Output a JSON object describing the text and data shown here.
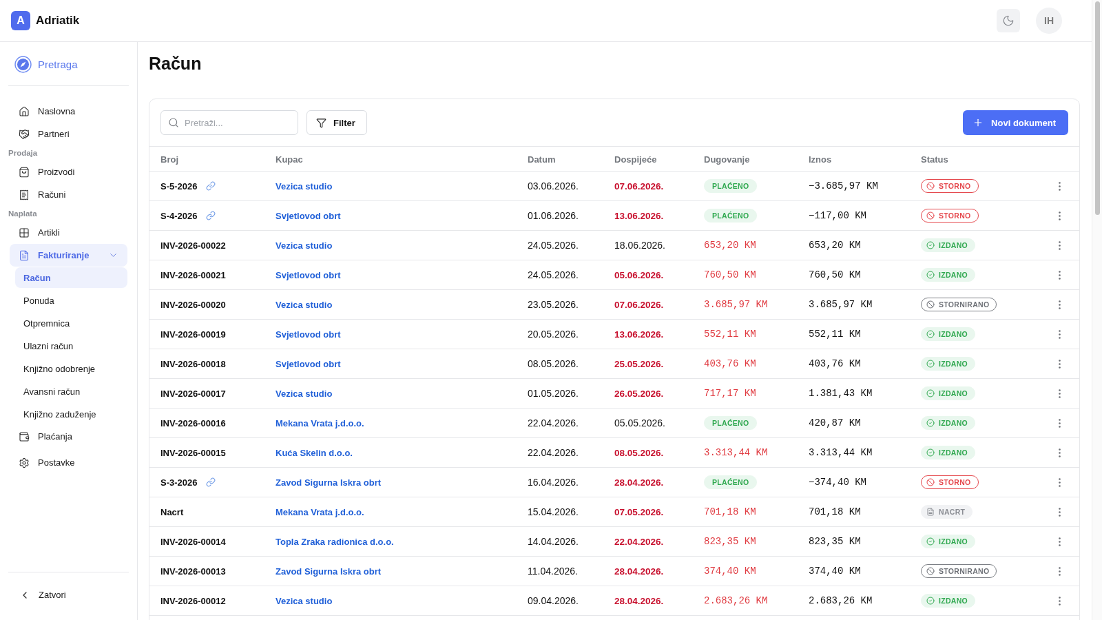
{
  "app": {
    "logo": "A",
    "name": "Adriatik"
  },
  "header": {
    "avatar": "IH"
  },
  "sidebar": {
    "search": "Pretraga",
    "items": [
      {
        "kind": "link",
        "label": "Naslovna",
        "selected": false
      },
      {
        "kind": "link",
        "label": "Partneri",
        "selected": false
      },
      {
        "kind": "section",
        "label": "Prodaja"
      },
      {
        "kind": "link",
        "label": "Proizvodi",
        "selected": false
      },
      {
        "kind": "link",
        "label": "Računi",
        "selected": false
      },
      {
        "kind": "section",
        "label": "Naplata"
      },
      {
        "kind": "link",
        "label": "Artikli",
        "selected": false
      },
      {
        "kind": "group",
        "label": "Fakturiranje",
        "selected": true,
        "expanded": true,
        "children": [
          {
            "label": "Račun",
            "selected": true
          },
          {
            "label": "Ponuda",
            "selected": false
          },
          {
            "label": "Otpremnica",
            "selected": false
          },
          {
            "label": "Ulazni račun",
            "selected": false
          },
          {
            "label": "Knjižno odobrenje",
            "selected": false
          },
          {
            "label": "Avansni račun",
            "selected": false
          },
          {
            "label": "Knjižno zaduženje",
            "selected": false
          }
        ]
      },
      {
        "kind": "link",
        "label": "Plaćanja",
        "selected": false
      },
      {
        "kind": "link",
        "label": "Postavke",
        "selected": false
      }
    ],
    "collapse": "Zatvori"
  },
  "page": {
    "title": "Račun"
  },
  "toolbar": {
    "search": {
      "placeholder": "Pretraži..."
    },
    "filter": "Filter",
    "new_document": "Novi dokument"
  },
  "table": {
    "columns": [
      "Broj",
      "Kupac",
      "Datum",
      "Dospijeće",
      "Dugovanje",
      "Iznos",
      "Status"
    ],
    "rows": [
      {
        "number": "S-5-2026",
        "linked": true,
        "customer": "Vezica studio",
        "date": "03.06.2026.",
        "due": "07.06.2026.",
        "overdue": true,
        "debt": {
          "kind": "badge",
          "text": "PLAĆENO"
        },
        "amount": "−3.685,97 KM",
        "status": {
          "kind": "storno",
          "text": "STORNO"
        }
      },
      {
        "number": "S-4-2026",
        "linked": true,
        "customer": "Svjetlovod obrt",
        "date": "01.06.2026.",
        "due": "13.06.2026.",
        "overdue": true,
        "debt": {
          "kind": "badge",
          "text": "PLAĆENO"
        },
        "amount": "−117,00 KM",
        "status": {
          "kind": "storno",
          "text": "STORNO"
        }
      },
      {
        "number": "INV-2026-00022",
        "linked": false,
        "customer": "Vezica studio",
        "date": "24.05.2026.",
        "due": "18.06.2026.",
        "overdue": false,
        "debt": {
          "kind": "amount",
          "text": "653,20 KM"
        },
        "amount": "653,20 KM",
        "status": {
          "kind": "issued",
          "text": "IZDANO"
        }
      },
      {
        "number": "INV-2026-00021",
        "linked": false,
        "customer": "Svjetlovod obrt",
        "date": "24.05.2026.",
        "due": "05.06.2026.",
        "overdue": true,
        "debt": {
          "kind": "amount",
          "text": "760,50 KM"
        },
        "amount": "760,50 KM",
        "status": {
          "kind": "issued",
          "text": "IZDANO"
        }
      },
      {
        "number": "INV-2026-00020",
        "linked": false,
        "customer": "Vezica studio",
        "date": "23.05.2026.",
        "due": "07.06.2026.",
        "overdue": true,
        "debt": {
          "kind": "amount",
          "text": "3.685,97 KM"
        },
        "amount": "3.685,97 KM",
        "status": {
          "kind": "cancelled",
          "text": "STORNIRANO"
        }
      },
      {
        "number": "INV-2026-00019",
        "linked": false,
        "customer": "Svjetlovod obrt",
        "date": "20.05.2026.",
        "due": "13.06.2026.",
        "overdue": true,
        "debt": {
          "kind": "amount",
          "text": "552,11 KM"
        },
        "amount": "552,11 KM",
        "status": {
          "kind": "issued",
          "text": "IZDANO"
        }
      },
      {
        "number": "INV-2026-00018",
        "linked": false,
        "customer": "Svjetlovod obrt",
        "date": "08.05.2026.",
        "due": "25.05.2026.",
        "overdue": true,
        "debt": {
          "kind": "amount",
          "text": "403,76 KM"
        },
        "amount": "403,76 KM",
        "status": {
          "kind": "issued",
          "text": "IZDANO"
        }
      },
      {
        "number": "INV-2026-00017",
        "linked": false,
        "customer": "Vezica studio",
        "date": "01.05.2026.",
        "due": "26.05.2026.",
        "overdue": true,
        "debt": {
          "kind": "amount",
          "text": "717,17 KM"
        },
        "amount": "1.381,43 KM",
        "status": {
          "kind": "issued",
          "text": "IZDANO"
        }
      },
      {
        "number": "INV-2026-00016",
        "linked": false,
        "customer": "Mekana Vrata j.d.o.o.",
        "date": "22.04.2026.",
        "due": "05.05.2026.",
        "overdue": false,
        "debt": {
          "kind": "badge",
          "text": "PLAĆENO"
        },
        "amount": "420,87 KM",
        "status": {
          "kind": "issued",
          "text": "IZDANO"
        }
      },
      {
        "number": "INV-2026-00015",
        "linked": false,
        "customer": "Kuća Skelin d.o.o.",
        "date": "22.04.2026.",
        "due": "08.05.2026.",
        "overdue": true,
        "debt": {
          "kind": "amount",
          "text": "3.313,44 KM"
        },
        "amount": "3.313,44 KM",
        "status": {
          "kind": "issued",
          "text": "IZDANO"
        }
      },
      {
        "number": "S-3-2026",
        "linked": true,
        "customer": "Zavod Sigurna Iskra obrt",
        "date": "16.04.2026.",
        "due": "28.04.2026.",
        "overdue": true,
        "debt": {
          "kind": "badge",
          "text": "PLAĆENO"
        },
        "amount": "−374,40 KM",
        "status": {
          "kind": "storno",
          "text": "STORNO"
        }
      },
      {
        "number": "Nacrt",
        "linked": false,
        "customer": "Mekana Vrata j.d.o.o.",
        "date": "15.04.2026.",
        "due": "07.05.2026.",
        "overdue": true,
        "debt": {
          "kind": "amount",
          "text": "701,18 KM"
        },
        "amount": "701,18 KM",
        "status": {
          "kind": "draft",
          "text": "NACRT"
        }
      },
      {
        "number": "INV-2026-00014",
        "linked": false,
        "customer": "Topla Zraka radionica d.o.o.",
        "date": "14.04.2026.",
        "due": "22.04.2026.",
        "overdue": true,
        "debt": {
          "kind": "amount",
          "text": "823,35 KM"
        },
        "amount": "823,35 KM",
        "status": {
          "kind": "issued",
          "text": "IZDANO"
        }
      },
      {
        "number": "INV-2026-00013",
        "linked": false,
        "customer": "Zavod Sigurna Iskra obrt",
        "date": "11.04.2026.",
        "due": "28.04.2026.",
        "overdue": true,
        "debt": {
          "kind": "amount",
          "text": "374,40 KM"
        },
        "amount": "374,40 KM",
        "status": {
          "kind": "cancelled",
          "text": "STORNIRANO"
        }
      },
      {
        "number": "INV-2026-00012",
        "linked": false,
        "customer": "Vezica studio",
        "date": "09.04.2026.",
        "due": "28.04.2026.",
        "overdue": true,
        "debt": {
          "kind": "amount",
          "text": "2.683,26 KM"
        },
        "amount": "2.683,26 KM",
        "status": {
          "kind": "issued",
          "text": "IZDANO"
        }
      }
    ]
  }
}
